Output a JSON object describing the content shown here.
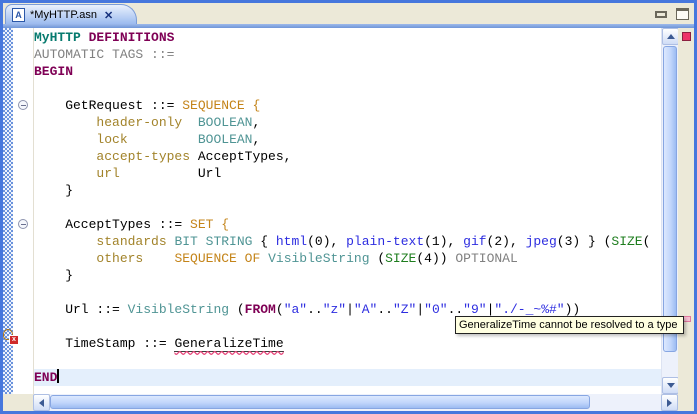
{
  "window": {
    "tab": {
      "title": "*MyHTTP.asn",
      "icon_letter": "A",
      "close_glyph": "✕"
    }
  },
  "colors": {
    "keyword": "#7f0055",
    "module": "#067a6e",
    "type": "#4f9494",
    "structure": "#c48419",
    "field": "#a2832a",
    "comment_gray": "#808080",
    "value_blue": "#2d2de0",
    "constraint_green": "#1e7d1e",
    "plain": "#000000",
    "error_squiggle": "#e8487c",
    "current_line": "#e4effc",
    "tab_gradient_top": "#eaf1fd",
    "tab_gradient_bottom": "#98b8ee",
    "error_indicator": "#ee3368"
  },
  "editor": {
    "fold_lines": [
      5,
      12
    ],
    "caret_line": 21,
    "lines": [
      {
        "segments": [
          [
            "module",
            "MyHTTP"
          ],
          [
            "plain",
            " "
          ],
          [
            "kw",
            "DEFINITIONS"
          ]
        ]
      },
      {
        "segments": [
          [
            "gray",
            "AUTOMATIC TAGS ::="
          ]
        ]
      },
      {
        "segments": [
          [
            "kw",
            "BEGIN"
          ]
        ]
      },
      {
        "segments": []
      },
      {
        "segments": [
          [
            "plain",
            "    GetRequest ::= "
          ],
          [
            "structure",
            "SEQUENCE {"
          ]
        ]
      },
      {
        "segments": [
          [
            "plain",
            "        "
          ],
          [
            "field",
            "header-only"
          ],
          [
            "plain",
            "  "
          ],
          [
            "type",
            "BOOLEAN"
          ],
          [
            "plain",
            ","
          ]
        ]
      },
      {
        "segments": [
          [
            "plain",
            "        "
          ],
          [
            "field",
            "lock"
          ],
          [
            "plain",
            "         "
          ],
          [
            "type",
            "BOOLEAN"
          ],
          [
            "plain",
            ","
          ]
        ]
      },
      {
        "segments": [
          [
            "plain",
            "        "
          ],
          [
            "field",
            "accept-types"
          ],
          [
            "plain",
            " AcceptTypes,"
          ]
        ]
      },
      {
        "segments": [
          [
            "plain",
            "        "
          ],
          [
            "field",
            "url"
          ],
          [
            "plain",
            "          Url"
          ]
        ]
      },
      {
        "segments": [
          [
            "plain",
            "    }"
          ]
        ]
      },
      {
        "segments": []
      },
      {
        "segments": [
          [
            "plain",
            "    AcceptTypes ::= "
          ],
          [
            "structure",
            "SET {"
          ]
        ]
      },
      {
        "segments": [
          [
            "plain",
            "        "
          ],
          [
            "field",
            "standards"
          ],
          [
            "plain",
            " "
          ],
          [
            "type",
            "BIT STRING"
          ],
          [
            "plain",
            " { "
          ],
          [
            "blue",
            "html"
          ],
          [
            "plain",
            "(0), "
          ],
          [
            "blue",
            "plain-text"
          ],
          [
            "plain",
            "(1), "
          ],
          [
            "blue",
            "gif"
          ],
          [
            "plain",
            "(2), "
          ],
          [
            "blue",
            "jpeg"
          ],
          [
            "plain",
            "(3) } ("
          ],
          [
            "green",
            "SIZE"
          ],
          [
            "plain",
            "("
          ]
        ]
      },
      {
        "segments": [
          [
            "plain",
            "        "
          ],
          [
            "field",
            "others"
          ],
          [
            "plain",
            "    "
          ],
          [
            "structure",
            "SEQUENCE OF"
          ],
          [
            "plain",
            " "
          ],
          [
            "type",
            "VisibleString"
          ],
          [
            "plain",
            " ("
          ],
          [
            "green",
            "SIZE"
          ],
          [
            "plain",
            "(4)) "
          ],
          [
            "gray",
            "OPTIONAL"
          ]
        ]
      },
      {
        "segments": [
          [
            "plain",
            "    }"
          ]
        ]
      },
      {
        "segments": []
      },
      {
        "segments": [
          [
            "plain",
            "    Url ::= "
          ],
          [
            "type",
            "VisibleString"
          ],
          [
            "plain",
            " ("
          ],
          [
            "kw",
            "FROM"
          ],
          [
            "plain",
            "("
          ],
          [
            "blue",
            "\"a\""
          ],
          [
            "plain",
            ".."
          ],
          [
            "blue",
            "\"z\""
          ],
          [
            "plain",
            "|"
          ],
          [
            "blue",
            "\"A\""
          ],
          [
            "plain",
            ".."
          ],
          [
            "blue",
            "\"Z\""
          ],
          [
            "plain",
            "|"
          ],
          [
            "blue",
            "\"0\""
          ],
          [
            "plain",
            ".."
          ],
          [
            "blue",
            "\"9\""
          ],
          [
            "plain",
            "|"
          ],
          [
            "blue",
            "\"./-_~%#\""
          ],
          [
            "plain",
            "))"
          ]
        ]
      },
      {
        "segments": []
      },
      {
        "segments": [
          [
            "plain",
            "    TimeStamp ::= "
          ],
          [
            "error",
            "GeneralizeTime"
          ]
        ]
      },
      {
        "segments": []
      },
      {
        "segments": [
          [
            "kw",
            "END"
          ],
          [
            "caret",
            ""
          ]
        ],
        "highlight": true
      }
    ]
  },
  "tooltip": {
    "text": "GeneralizeTime cannot be resolved to a type"
  }
}
